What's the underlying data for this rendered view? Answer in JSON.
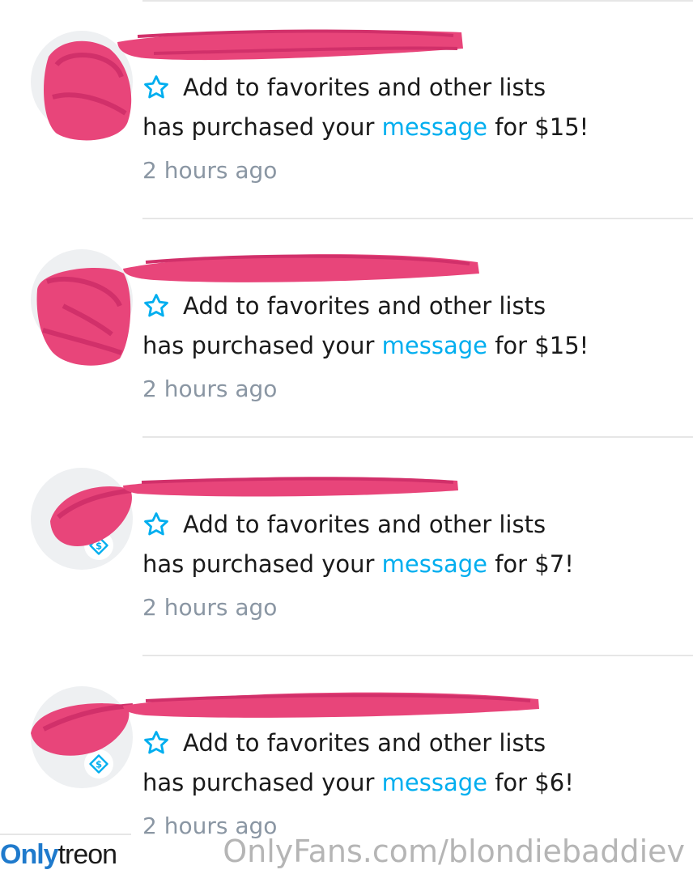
{
  "notifications": [
    {
      "fav_label": "Add to favorites and other lists",
      "purchase_prefix": "has purchased your",
      "purchase_link": "message",
      "purchase_suffix": "for $15!",
      "time": "2 hours ago"
    },
    {
      "fav_label": "Add to favorites and other lists",
      "purchase_prefix": "has purchased your",
      "purchase_link": "message",
      "purchase_suffix": "for $15!",
      "time": "2 hours ago"
    },
    {
      "fav_label": "Add to favorites and other lists",
      "purchase_prefix": "has purchased your",
      "purchase_link": "message",
      "purchase_suffix": "for $7!",
      "time": "2 hours ago"
    },
    {
      "fav_label": "Add to favorites and other lists",
      "purchase_prefix": "has purchased your",
      "purchase_link": "message",
      "purchase_suffix": "for $6!",
      "time": "2 hours ago"
    }
  ],
  "watermark": {
    "site": "OnlyFans.com/blondiebaddiev",
    "logo_part1": "Only",
    "logo_part2": "treon"
  },
  "colors": {
    "accent": "#00aeef",
    "redaction": "#e8457a",
    "muted": "#8a96a3"
  },
  "icons": {
    "favorite": "star-outline-icon",
    "tip": "dollar-tag-icon"
  }
}
